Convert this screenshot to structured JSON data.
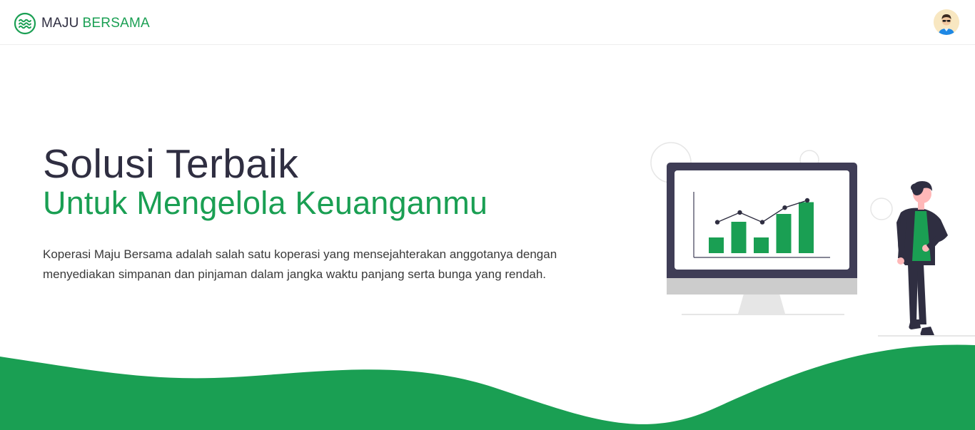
{
  "navbar": {
    "brand": {
      "logo_icon": "waves-logo-icon",
      "name_primary": "MAJU",
      "name_accent": "BERSAMA"
    },
    "avatar_icon": "user-avatar-icon"
  },
  "hero": {
    "title": "Solusi Terbaik",
    "subtitle": "Untuk Mengelola Keuanganmu",
    "description": "Koperasi Maju Bersama adalah salah satu koperasi yang mensejahterakan anggotanya dengan menyediakan simpanan dan pinjaman dalam jangka waktu panjang serta bunga yang rendah."
  },
  "illustration": {
    "icon": "financial-growth-illustration",
    "chart_data": {
      "type": "bar",
      "values": [
        2,
        4,
        2,
        5,
        6.5
      ],
      "line_values": [
        3,
        5,
        3,
        6,
        7.5
      ]
    }
  },
  "colors": {
    "accent": "#1a9f53",
    "dark": "#2f2e41",
    "monitor_frame": "#3f3d56",
    "light_gray": "#e6e6e6"
  }
}
